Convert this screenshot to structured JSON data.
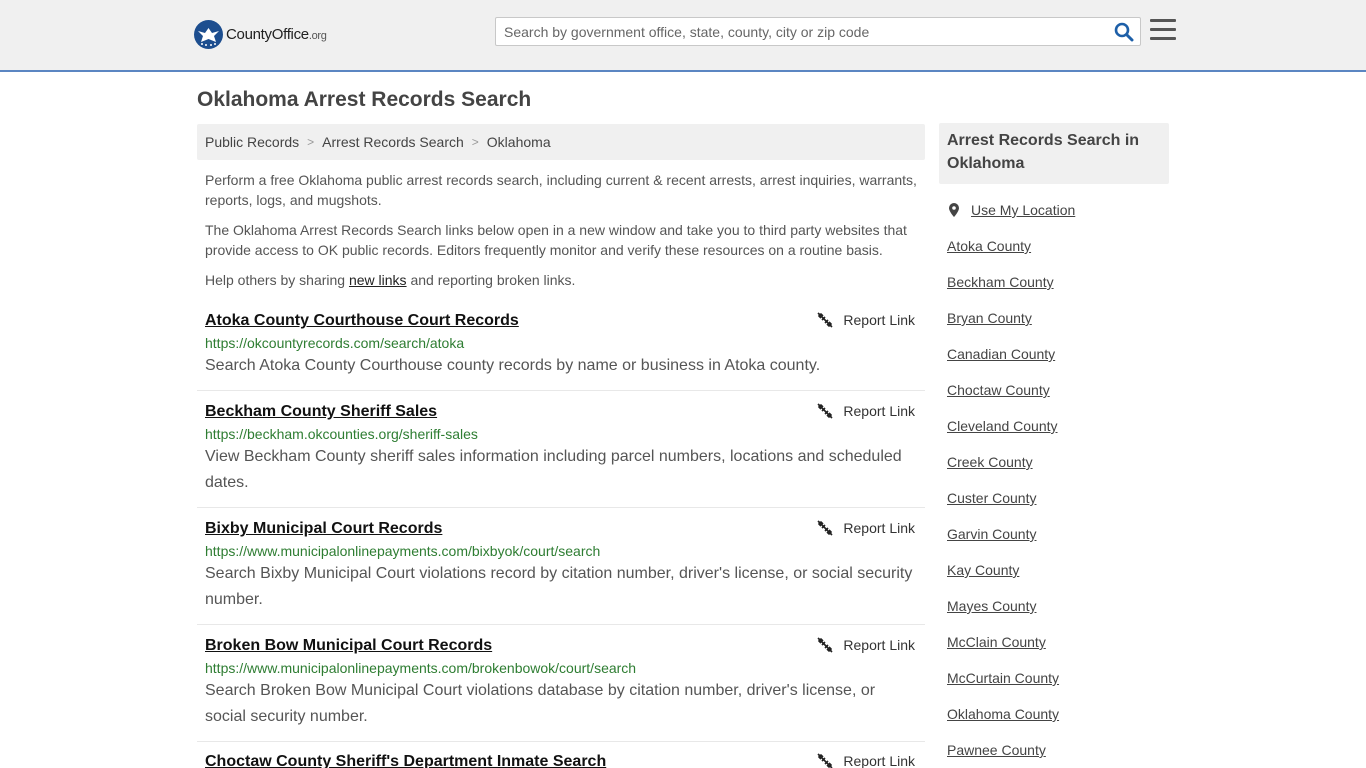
{
  "header": {
    "logo_name": "CountyOffice",
    "logo_suffix": ".org",
    "search_placeholder": "Search by government office, state, county, city or zip code"
  },
  "page_title": "Oklahoma Arrest Records Search",
  "breadcrumb": [
    "Public Records",
    "Arrest Records Search",
    "Oklahoma"
  ],
  "intro": {
    "p1": "Perform a free Oklahoma public arrest records search, including current & recent arrests, arrest inquiries, warrants, reports, logs, and mugshots.",
    "p2": "The Oklahoma Arrest Records Search links below open in a new window and take you to third party websites that provide access to OK public records. Editors frequently monitor and verify these resources on a routine basis.",
    "p3_before": "Help others by sharing ",
    "p3_link": "new links",
    "p3_after": " and reporting broken links."
  },
  "report_label": "Report Link",
  "results": [
    {
      "title": "Atoka County Courthouse Court Records",
      "url": "https://okcountyrecords.com/search/atoka",
      "desc": "Search Atoka County Courthouse county records by name or business in Atoka county."
    },
    {
      "title": "Beckham County Sheriff Sales",
      "url": "https://beckham.okcounties.org/sheriff-sales",
      "desc": "View Beckham County sheriff sales information including parcel numbers, locations and scheduled dates."
    },
    {
      "title": "Bixby Municipal Court Records",
      "url": "https://www.municipalonlinepayments.com/bixbyok/court/search",
      "desc": "Search Bixby Municipal Court violations record by citation number, driver's license, or social security number."
    },
    {
      "title": "Broken Bow Municipal Court Records",
      "url": "https://www.municipalonlinepayments.com/brokenbowok/court/search",
      "desc": "Search Broken Bow Municipal Court violations database by citation number, driver's license, or social security number."
    },
    {
      "title": "Choctaw County Sheriff's Department Inmate Search",
      "url": "",
      "desc": ""
    }
  ],
  "sidebar": {
    "title": "Arrest Records Search in Oklahoma",
    "use_location": "Use My Location",
    "counties": [
      "Atoka County",
      "Beckham County",
      "Bryan County",
      "Canadian County",
      "Choctaw County",
      "Cleveland County",
      "Creek County",
      "Custer County",
      "Garvin County",
      "Kay County",
      "Mayes County",
      "McClain County",
      "McCurtain County",
      "Oklahoma County",
      "Pawnee County"
    ]
  },
  "colors": {
    "header_bg": "#f0f0f0",
    "header_border": "#5b86c2",
    "url_green": "#2e7d32",
    "logo_blue": "#1d4e8f",
    "search_icon_blue": "#1d5fa8"
  }
}
